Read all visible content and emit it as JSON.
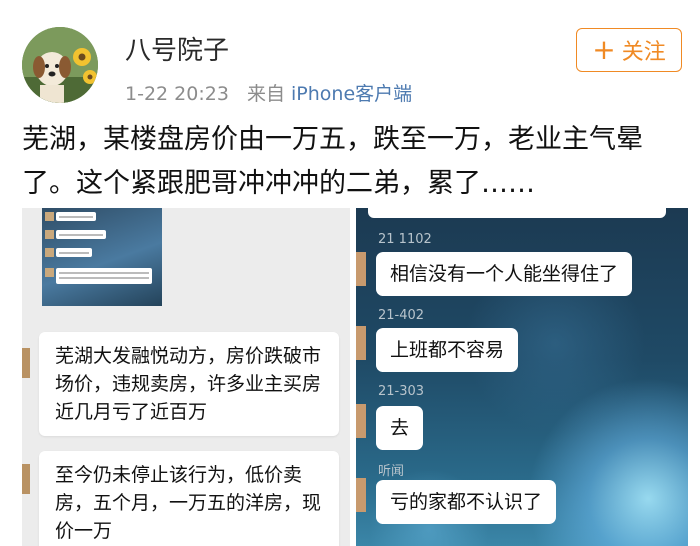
{
  "user": {
    "name": "八号院子",
    "time": "1-22 20:23",
    "from_prefix": "来自",
    "source": "iPhone客户端"
  },
  "follow_button": {
    "label": "关注"
  },
  "post": {
    "text": "芜湖，某楼盘房价由一万五，跌至一万，老业主气晕了。这个紧跟肥哥冲冲冲的二弟，累了……"
  },
  "left_screenshot": {
    "messages": [
      "芜湖大发融悦动方，房价跌破市场价，违规卖房，许多业主买房近几月亏了近百万",
      "至今仍未停止该行为，低价卖房，五个月，一万五的洋房，现价一万"
    ]
  },
  "right_screenshot": {
    "messages": [
      {
        "sender": "21  1102",
        "text": "相信没有一个人能坐得住了"
      },
      {
        "sender": "21-402",
        "text": "上班都不容易"
      },
      {
        "sender": "21-303",
        "text": "去"
      },
      {
        "sender": "听闻",
        "text": "亏的家都不认识了"
      }
    ]
  },
  "colors": {
    "accent": "#f08a24",
    "source_link": "#4d7ab0",
    "meta_gray": "#8c8c8c"
  }
}
